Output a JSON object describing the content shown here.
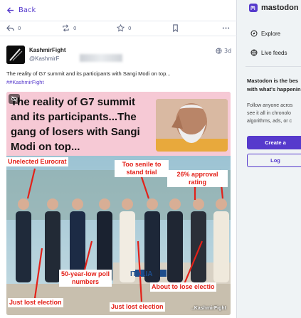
{
  "nav": {
    "back_label": "Back"
  },
  "actions": {
    "reply_count": "0",
    "boost_count": "0",
    "favourite_count": "0"
  },
  "post": {
    "display_name": "KashmirFight",
    "handle": "@KashmirF",
    "age": "3d",
    "text": "The reality of G7 summit and its participants with Sangi Modi on top...",
    "hashtag": "##KashmirFight",
    "media": {
      "headline": "The reality of G7 summit and its participants...The gang of losers with Sangi Modi on top...",
      "labels": {
        "eurocrat": "Unelected Eurocrat",
        "senile": "Too senile to stand trial",
        "approval": "26% approval rating",
        "poll": "50-year-low poll numbers",
        "lost_left": "Just lost election",
        "lost_mid": "Just lost election",
        "about_lose": "About to lose electio"
      },
      "banner": "ITALIA",
      "caption": "..KashmirFight"
    }
  },
  "sidebar": {
    "brand": "mastodon",
    "explore_label": "Explore",
    "live_feeds_label": "Live feeds",
    "about_title_1": "Mastodon is the bes",
    "about_title_2": "with what's happenin",
    "about_body_1": "Follow anyone acros",
    "about_body_2": "see it all in chronolo",
    "about_body_3": "algorithms, ads, or c",
    "create_account_label": "Create a",
    "login_label": "Log"
  },
  "colors": {
    "accent": "#563acc",
    "label_red": "#e32119",
    "headline_bg": "#f6c9d5"
  }
}
